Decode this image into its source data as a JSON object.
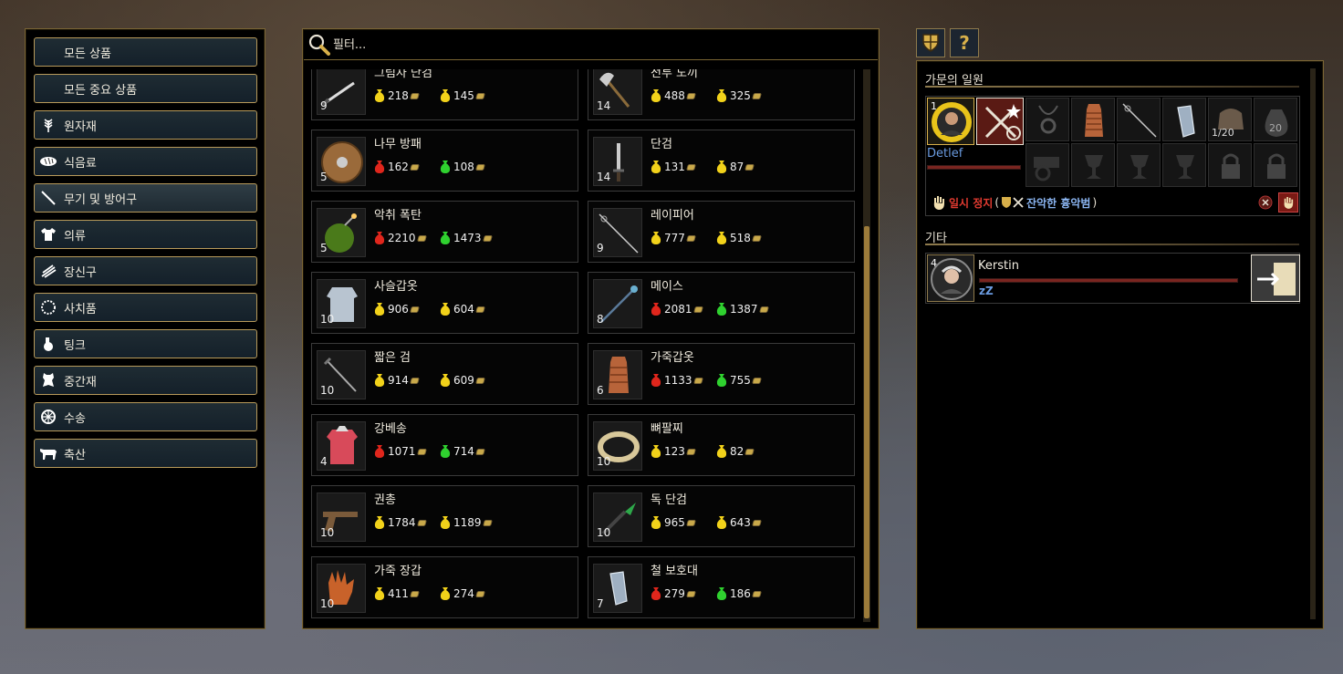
{
  "filter": {
    "placeholder": "필터..."
  },
  "categories": [
    {
      "label": "모든 상품",
      "icon": "none"
    },
    {
      "label": "모든 중요 상품",
      "icon": "none"
    },
    {
      "label": "원자재",
      "icon": "wheat-icon"
    },
    {
      "label": "식음료",
      "icon": "bread-icon"
    },
    {
      "label": "무기 및 방어구",
      "icon": "sword-icon"
    },
    {
      "label": "의류",
      "icon": "shirt-icon"
    },
    {
      "label": "장신구",
      "icon": "jewelry-icon"
    },
    {
      "label": "사치품",
      "icon": "necklace-icon"
    },
    {
      "label": "팅크",
      "icon": "flask-icon"
    },
    {
      "label": "중간재",
      "icon": "hide-icon"
    },
    {
      "label": "수송",
      "icon": "wheel-icon"
    },
    {
      "label": "축산",
      "icon": "cow-icon"
    }
  ],
  "selected_category": "무기 및 방어구",
  "items": [
    {
      "name": "그림자 단검",
      "qty": "9",
      "buy": "218",
      "sell": "145",
      "buy_color": "yellow",
      "sell_color": "yellow",
      "icon": "shadow-dagger-icon"
    },
    {
      "name": "전투 도끼",
      "qty": "14",
      "buy": "488",
      "sell": "325",
      "buy_color": "yellow",
      "sell_color": "yellow",
      "icon": "battle-axe-icon"
    },
    {
      "name": "나무 방패",
      "qty": "5",
      "buy": "162",
      "sell": "108",
      "buy_color": "red",
      "sell_color": "green",
      "icon": "wooden-shield-icon"
    },
    {
      "name": "단검",
      "qty": "14",
      "buy": "131",
      "sell": "87",
      "buy_color": "yellow",
      "sell_color": "yellow",
      "icon": "dagger-icon"
    },
    {
      "name": "악취 폭탄",
      "qty": "5",
      "buy": "2210",
      "sell": "1473",
      "buy_color": "red",
      "sell_color": "green",
      "icon": "stink-bomb-icon"
    },
    {
      "name": "레이피어",
      "qty": "9",
      "buy": "777",
      "sell": "518",
      "buy_color": "yellow",
      "sell_color": "yellow",
      "icon": "rapier-icon"
    },
    {
      "name": "사슬갑옷",
      "qty": "10",
      "buy": "906",
      "sell": "604",
      "buy_color": "yellow",
      "sell_color": "yellow",
      "icon": "chainmail-icon"
    },
    {
      "name": "메이스",
      "qty": "8",
      "buy": "2081",
      "sell": "1387",
      "buy_color": "red",
      "sell_color": "green",
      "icon": "mace-icon"
    },
    {
      "name": "짧은 검",
      "qty": "10",
      "buy": "914",
      "sell": "609",
      "buy_color": "yellow",
      "sell_color": "yellow",
      "icon": "short-sword-icon"
    },
    {
      "name": "가죽갑옷",
      "qty": "6",
      "buy": "1133",
      "sell": "755",
      "buy_color": "red",
      "sell_color": "green",
      "icon": "leather-armor-icon"
    },
    {
      "name": "강베송",
      "qty": "4",
      "buy": "1071",
      "sell": "714",
      "buy_color": "red",
      "sell_color": "green",
      "icon": "gambeson-icon"
    },
    {
      "name": "뼈팔찌",
      "qty": "10",
      "buy": "123",
      "sell": "82",
      "buy_color": "yellow",
      "sell_color": "yellow",
      "icon": "bone-bracelet-icon"
    },
    {
      "name": "권총",
      "qty": "10",
      "buy": "1784",
      "sell": "1189",
      "buy_color": "yellow",
      "sell_color": "yellow",
      "icon": "pistol-icon"
    },
    {
      "name": "독 단검",
      "qty": "10",
      "buy": "965",
      "sell": "643",
      "buy_color": "yellow",
      "sell_color": "yellow",
      "icon": "poison-dagger-icon"
    },
    {
      "name": "가죽 장갑",
      "qty": "10",
      "buy": "411",
      "sell": "274",
      "buy_color": "yellow",
      "sell_color": "yellow",
      "icon": "leather-gloves-icon"
    },
    {
      "name": "철 보호대",
      "qty": "7",
      "buy": "279",
      "sell": "186",
      "buy_color": "red",
      "sell_color": "green",
      "icon": "iron-bracer-icon"
    }
  ],
  "colors": {
    "yellow": "#f2d21a",
    "red": "#e0261c",
    "green": "#2fd12f",
    "gold": "#7a6534"
  },
  "right": {
    "family_title": "가문의 일원",
    "member": {
      "name": "Detlef",
      "level": "1",
      "bag_count": "1/20",
      "sack_count": "20"
    },
    "status": {
      "label": "일시 정지",
      "open": "(",
      "crime": "잔악한 흉악범",
      "close": ")"
    },
    "other_title": "기타",
    "other": {
      "name": "Kerstin",
      "level": "4",
      "sleep": "zZ"
    }
  }
}
